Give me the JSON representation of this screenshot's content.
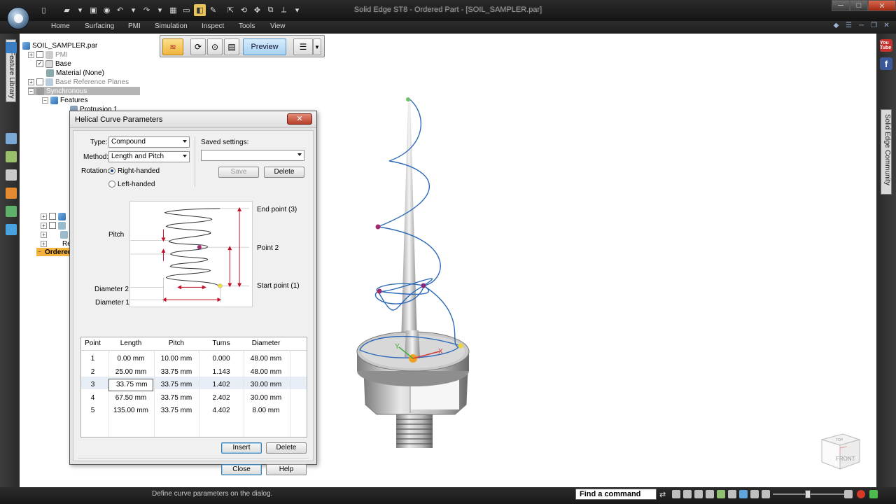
{
  "window": {
    "title": "Solid Edge ST8 - Ordered Part - [SOIL_SAMPLER.par]"
  },
  "ribbon": {
    "tabs": [
      "Home",
      "Surfacing",
      "PMI",
      "Simulation",
      "Inspect",
      "Tools",
      "View"
    ]
  },
  "left_panel": {
    "feature_library_label": "Feature Library"
  },
  "right_panel": {
    "community_label": "Solid Edge Community",
    "youtube_label": "You Tube",
    "facebook_label": "f"
  },
  "tree": {
    "file": "SOIL_SAMPLER.par",
    "pmi": "PMI",
    "base": "Base",
    "material": "Material (None)",
    "base_reference_planes": "Base Reference Planes",
    "synchronous": "Synchronous",
    "features": "Features",
    "protrusion": "Protrusion 1",
    "partial_re": "Re",
    "ordered": "Ordered"
  },
  "command_bar": {
    "preview_label": "Preview"
  },
  "dialog": {
    "title": "Helical Curve Parameters",
    "close_x": "✕",
    "type_label": "Type:",
    "type_value": "Compound",
    "method_label": "Method:",
    "method_value": "Length and Pitch",
    "rotation_label": "Rotation:",
    "right_handed": "Right-handed",
    "left_handed": "Left-handed",
    "saved_settings_label": "Saved settings:",
    "saved_settings_value": "",
    "save_button": "Save",
    "delete_settings_button": "Delete",
    "diagram": {
      "pitch": "Pitch",
      "diameter2": "Diameter 2",
      "diameter1": "Diameter 1",
      "end_point": "End point (3)",
      "point2": "Point 2",
      "start_point": "Start point (1)"
    },
    "grid": {
      "headers": [
        "Point",
        "Length",
        "Pitch",
        "Turns",
        "Diameter"
      ],
      "rows": [
        [
          "1",
          "0.00 mm",
          "10.00 mm",
          "0.000",
          "48.00 mm"
        ],
        [
          "2",
          "25.00 mm",
          "33.75 mm",
          "1.143",
          "48.00 mm"
        ],
        [
          "3",
          "33.75 mm",
          "33.75 mm",
          "1.402",
          "30.00 mm"
        ],
        [
          "4",
          "67.50 mm",
          "33.75 mm",
          "2.402",
          "30.00 mm"
        ],
        [
          "5",
          "135.00 mm",
          "33.75 mm",
          "4.402",
          "8.00 mm"
        ]
      ],
      "selected_row": 3
    },
    "insert_button": "Insert",
    "delete_button": "Delete",
    "close_button": "Close",
    "help_button": "Help"
  },
  "status": {
    "message": "Define curve parameters on the dialog.",
    "find_command": "Find a command"
  },
  "viewcube": {
    "front_label": "FRONT",
    "top_label": "TOP"
  },
  "model_axes": {
    "x": "X",
    "y": "Y"
  }
}
